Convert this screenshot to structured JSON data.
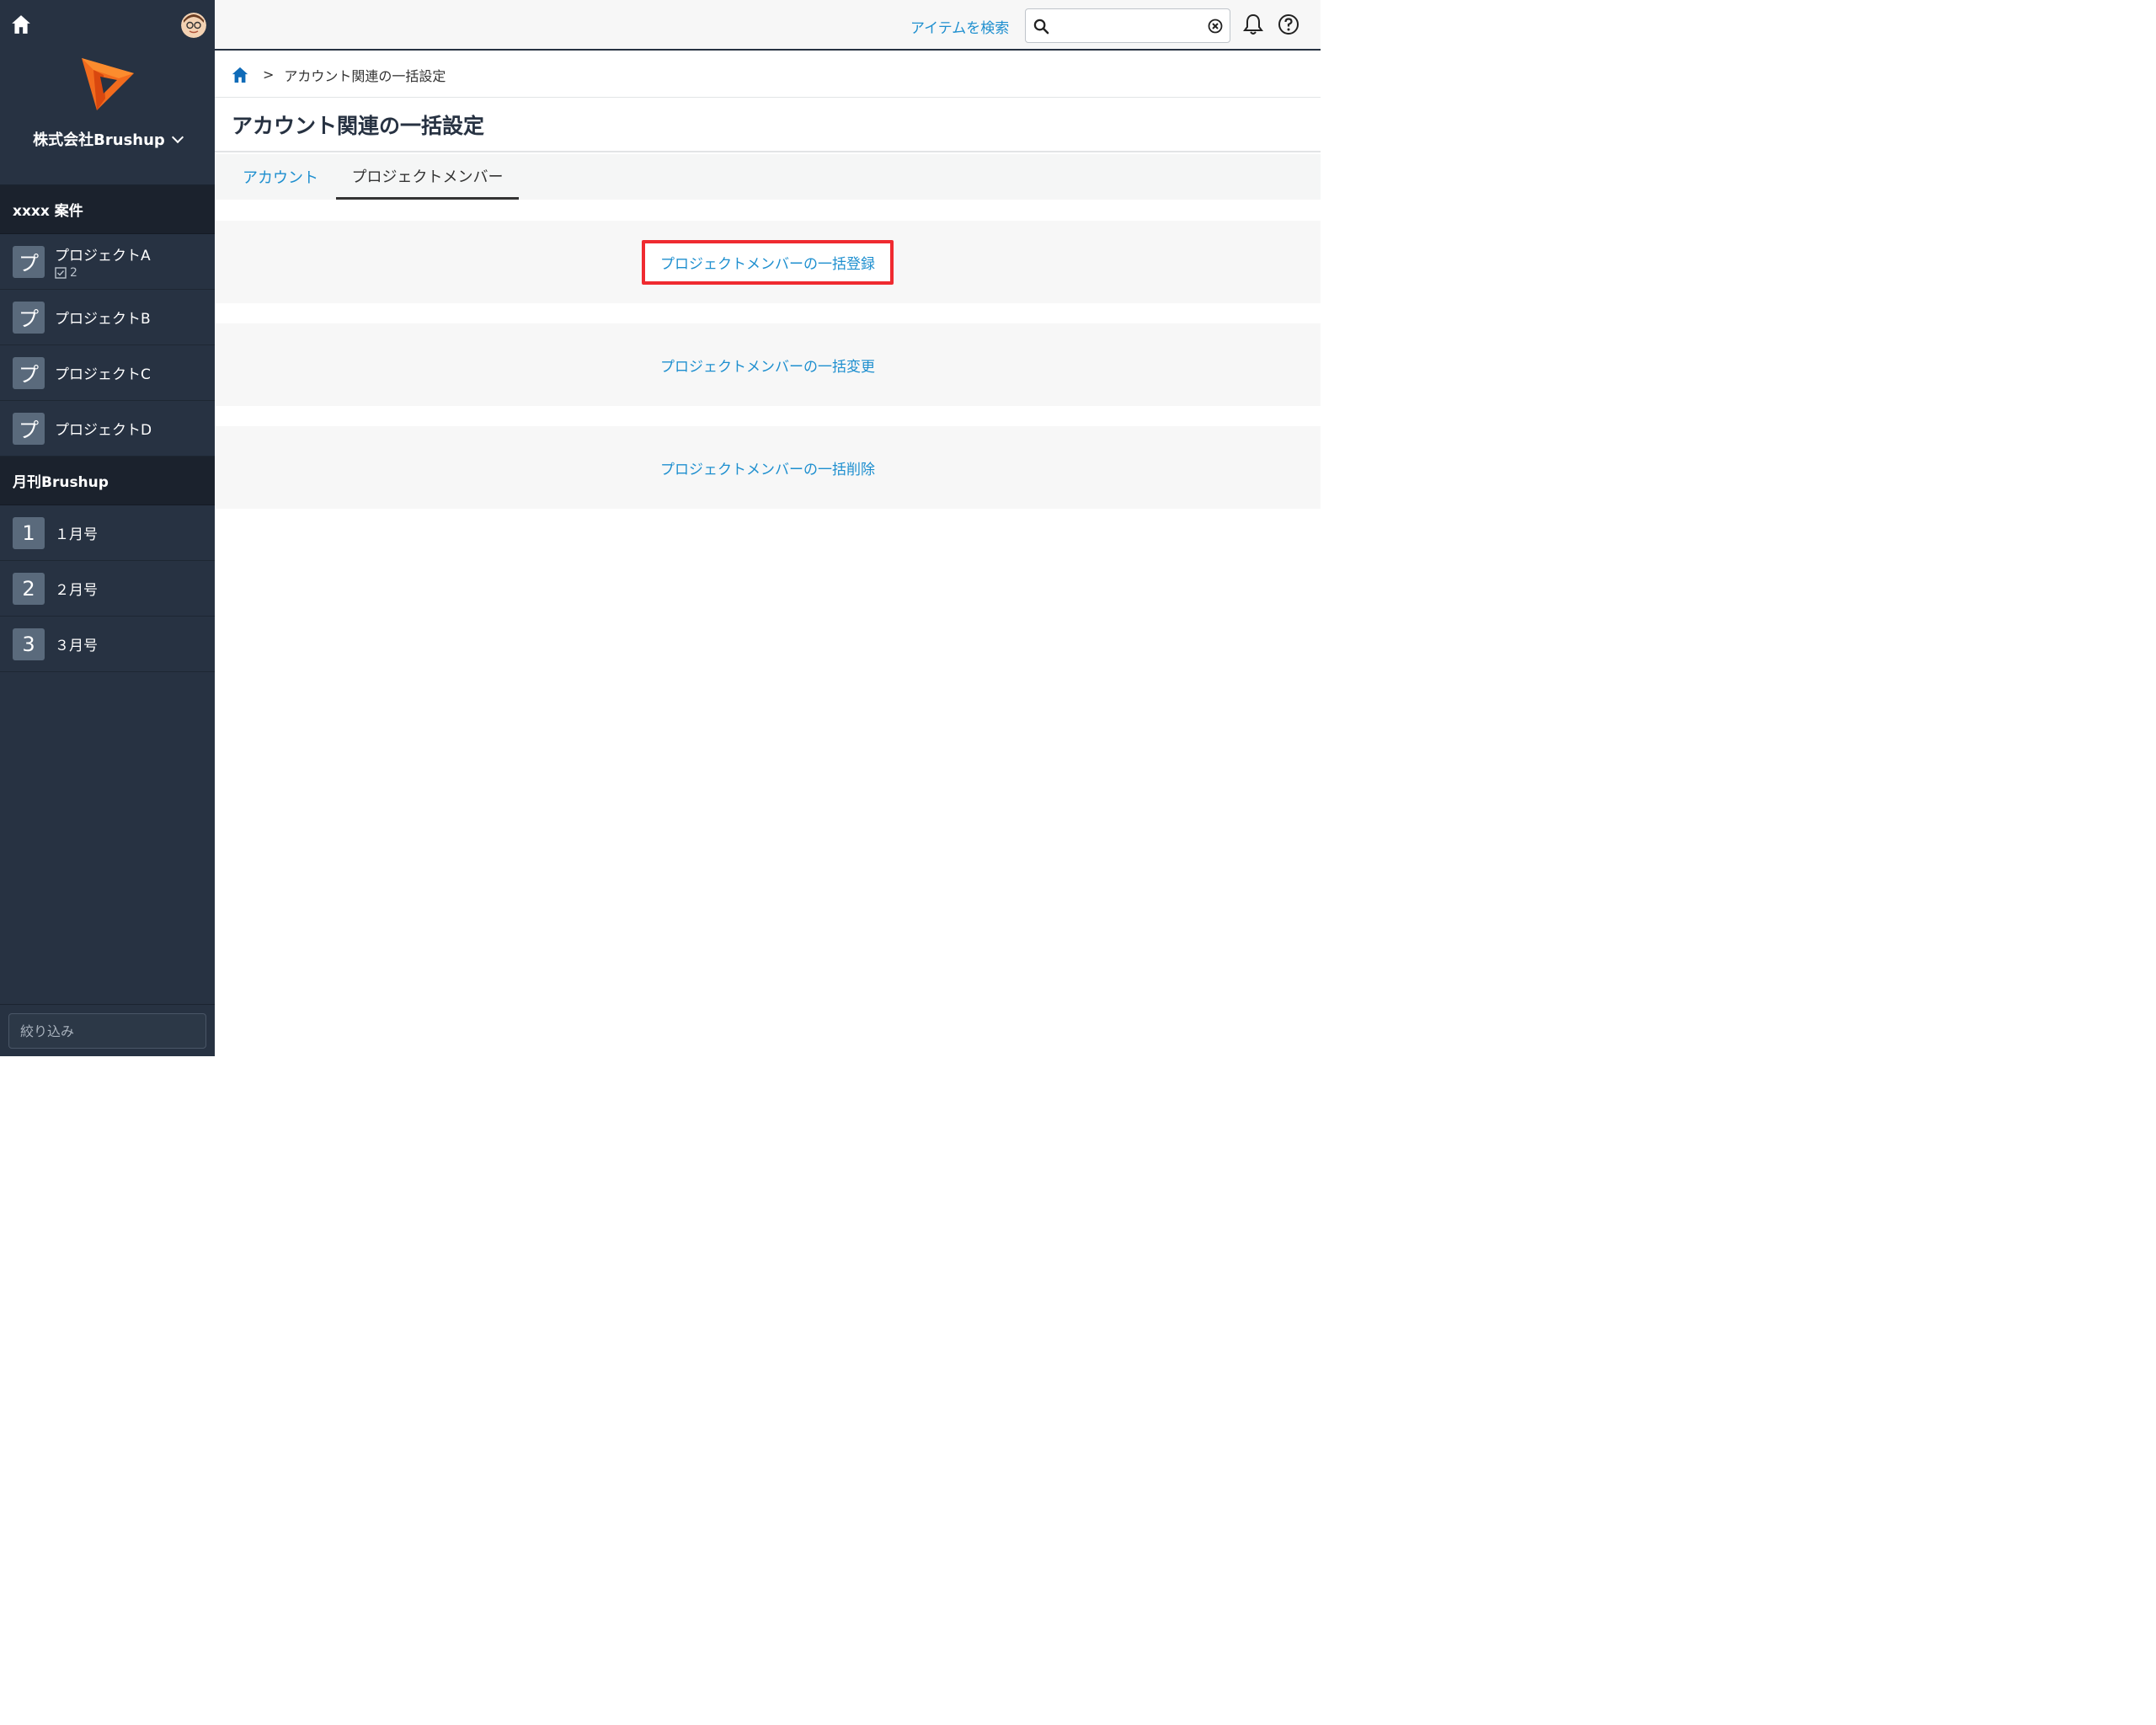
{
  "sidebar": {
    "org_name": "株式会社Brushup",
    "groups": [
      {
        "title": "xxxx 案件",
        "items": [
          {
            "badge": "プ",
            "label": "プロジェクトA",
            "count": "2"
          },
          {
            "badge": "プ",
            "label": "プロジェクトB"
          },
          {
            "badge": "プ",
            "label": "プロジェクトC"
          },
          {
            "badge": "プ",
            "label": "プロジェクトD"
          }
        ]
      },
      {
        "title": "月刊Brushup",
        "items": [
          {
            "badge": "1",
            "label": "１月号"
          },
          {
            "badge": "2",
            "label": "２月号"
          },
          {
            "badge": "3",
            "label": "３月号"
          }
        ]
      }
    ],
    "filter_placeholder": "絞り込み"
  },
  "topbar": {
    "search_link": "アイテムを検索",
    "search_value": ""
  },
  "breadcrumb": {
    "separator": ">",
    "current": "アカウント関連の一括設定"
  },
  "page": {
    "title": "アカウント関連の一括設定",
    "tabs": [
      {
        "label": "アカウント",
        "active": false
      },
      {
        "label": "プロジェクトメンバー",
        "active": true
      }
    ],
    "actions": [
      {
        "label": "プロジェクトメンバーの一括登録",
        "highlighted": true
      },
      {
        "label": "プロジェクトメンバーの一括変更",
        "highlighted": false
      },
      {
        "label": "プロジェクトメンバーの一括削除",
        "highlighted": false
      }
    ]
  },
  "colors": {
    "sidebar_bg": "#273242",
    "link": "#1e8fcf",
    "highlight_border": "#ef2a30",
    "logo_orange": "#f26b1d"
  },
  "icons": [
    "home-icon",
    "avatar",
    "brand-logo",
    "chevron-down-icon",
    "checkbox-icon",
    "search-icon",
    "clear-icon",
    "bell-icon",
    "help-icon"
  ]
}
